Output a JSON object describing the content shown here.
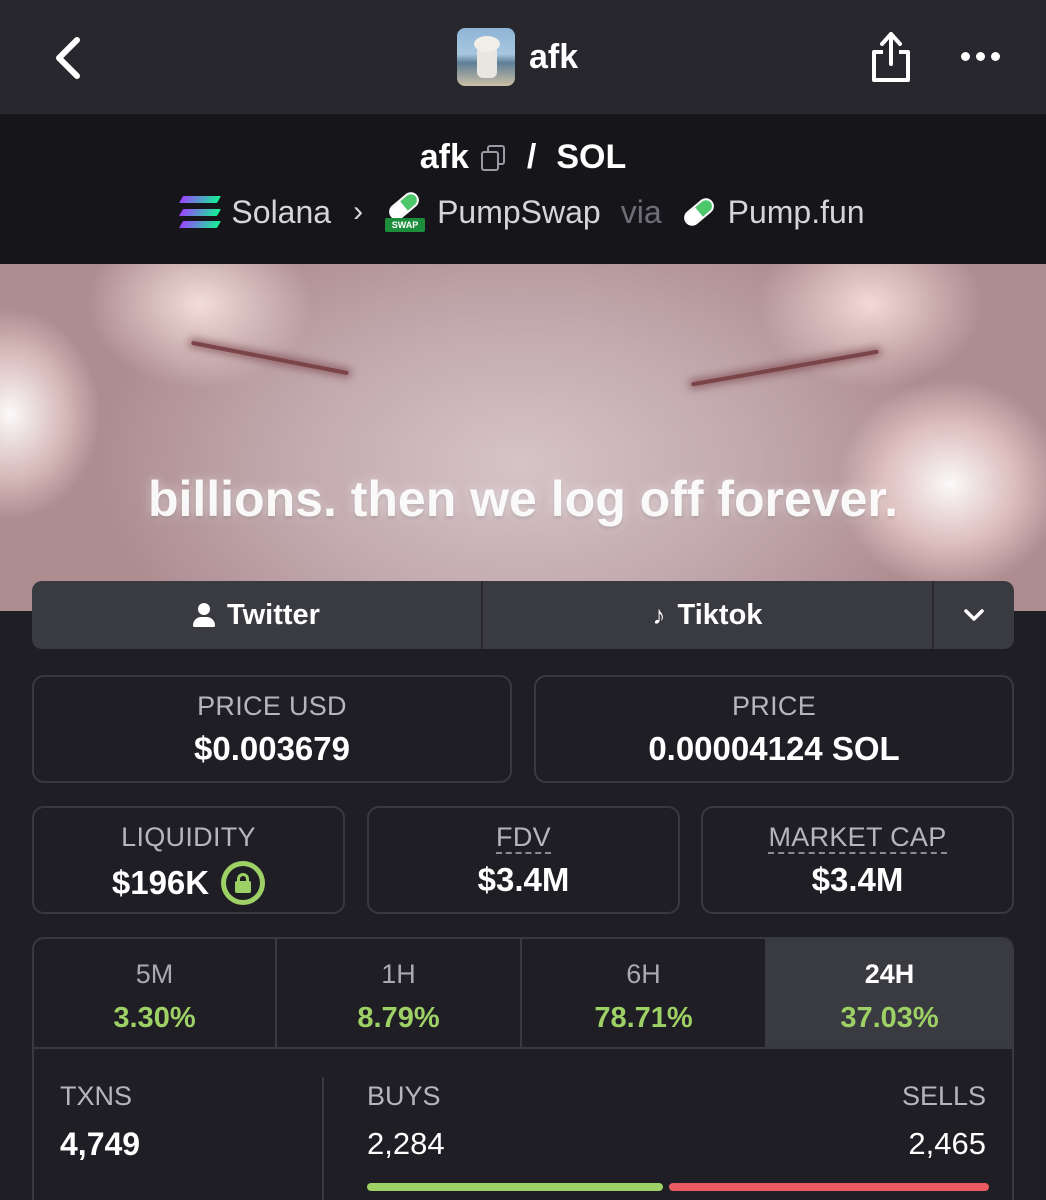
{
  "nav": {
    "title": "afk",
    "icons": [
      "chevron-left-icon",
      "share-icon",
      "more-horizontal-icon"
    ]
  },
  "pair": {
    "base": "afk",
    "separator": "/",
    "quote": "SOL",
    "chain": "Solana",
    "dex": "PumpSwap",
    "via_label": "via",
    "launchpad": "Pump.fun",
    "swap_tag": "SWAP"
  },
  "banner": {
    "text": "billions. then we log off forever."
  },
  "links": {
    "twitter": "Twitter",
    "tiktok": "Tiktok"
  },
  "stats": {
    "price_usd_label": "PRICE USD",
    "price_usd": "$0.003679",
    "price_label": "PRICE",
    "price": "0.00004124 SOL",
    "liquidity_label": "LIQUIDITY",
    "liquidity": "$196K",
    "fdv_label": "FDV",
    "fdv": "$3.4M",
    "mcap_label": "MARKET CAP",
    "mcap": "$3.4M"
  },
  "periods": [
    {
      "label": "5M",
      "change": "3.30%"
    },
    {
      "label": "1H",
      "change": "8.79%"
    },
    {
      "label": "6H",
      "change": "78.71%"
    },
    {
      "label": "24H",
      "change": "37.03%"
    }
  ],
  "active_period": "24H",
  "txns": {
    "txns_label": "TXNS",
    "txns": "4,749",
    "buys_label": "BUYS",
    "buys": "2,284",
    "sells_label": "SELLS",
    "sells": "2,465",
    "buy_fraction": 0.481
  },
  "colors": {
    "positive": "#9ed165",
    "negative": "#ec5b63",
    "background": "#1e1e24"
  }
}
